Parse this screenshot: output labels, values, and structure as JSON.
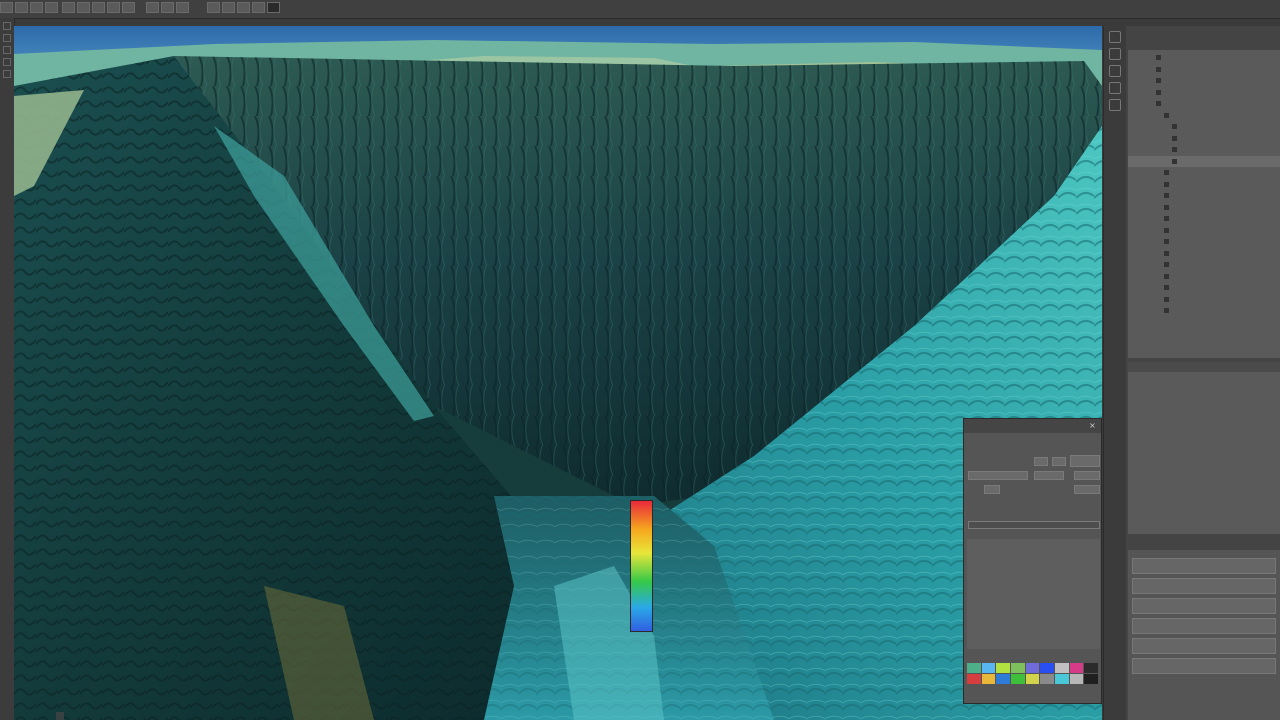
{
  "toolbar": {
    "groups": [
      {
        "name": "file-tools",
        "count": 4
      },
      {
        "name": "edit-tools",
        "count": 5
      },
      {
        "name": "view-tools",
        "count": 4
      },
      {
        "name": "render-tools",
        "count": 4
      }
    ]
  },
  "viewport": {
    "coord_readout": "",
    "legend_label": ""
  },
  "properties_panel": {
    "title": "",
    "heading": "",
    "list_items": [
      "",
      "",
      "",
      "",
      "",
      "",
      ""
    ],
    "swatches": [
      "#4fae8a",
      "#58b6f0",
      "#b2e041",
      "#7ec15c",
      "#6f6bd8",
      "#2a4ff0",
      "#c0c0c0",
      "#d53b86",
      "#2b2b2b",
      "#d43e3e",
      "#e9b73a",
      "#2f7bd8",
      "#3fc03a",
      "#d2d34a",
      "#8a8a8a",
      "#49c8d8",
      "#b7b7b7",
      "#1f1f1f"
    ]
  },
  "right_panel": {
    "tree_title": "",
    "tree_items": [
      "",
      "",
      "",
      "",
      "",
      "",
      "",
      "",
      "",
      "",
      "",
      "",
      "",
      "",
      "",
      "",
      "",
      "",
      "",
      "",
      "",
      "",
      ""
    ],
    "selected_index": 9,
    "mid_label": "",
    "mid_header": "",
    "bottom_label": "",
    "bottom_rows": [
      "",
      "",
      "",
      "",
      "",
      ""
    ]
  },
  "colors": {
    "ui_dark": "#3a3a3a",
    "panel": "#5a5a5a",
    "sky": "#2f6fb0",
    "terrain_teal": "#2f9fa0",
    "terrain_dark": "#0f2f33"
  }
}
